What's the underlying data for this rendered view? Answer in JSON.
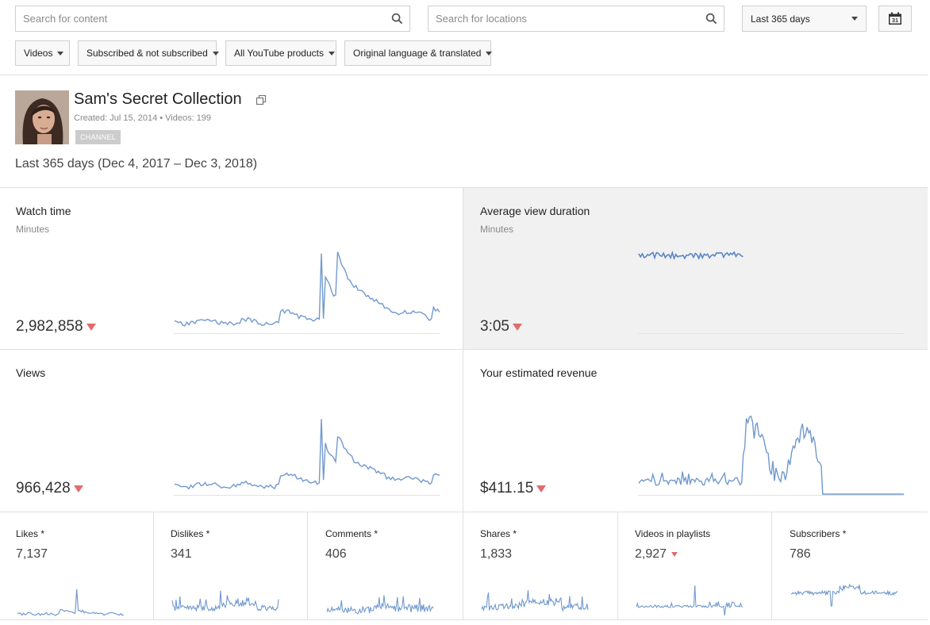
{
  "filters": {
    "search_content_placeholder": "Search for content",
    "search_locations_placeholder": "Search for locations",
    "date_range": "Last 365 days",
    "calendar_day": "31",
    "chips": [
      "Videos",
      "Subscribed & not subscribed",
      "All YouTube products",
      "Original language & translated"
    ]
  },
  "channel": {
    "name": "Sam's Secret Collection",
    "meta": "Created: Jul 15, 2014  •  Videos: 199",
    "badge": "CHANNEL"
  },
  "range_label": "Last 365 days (Dec 4, 2017 – Dec 3, 2018)",
  "colors": {
    "line": "#7199cf",
    "down": "#e06c6c",
    "card_highlight": "#f1f1f1"
  },
  "cards": {
    "watch_time": {
      "title": "Watch time",
      "sub": "Minutes",
      "value": "2,982,858",
      "trend": "down"
    },
    "avg_view_duration": {
      "title": "Average view duration",
      "sub": "Minutes",
      "value": "3:05",
      "trend": "down"
    },
    "views": {
      "title": "Views",
      "value": "966,428",
      "trend": "down"
    },
    "revenue": {
      "title": "Your estimated revenue",
      "value": "$411.15",
      "trend": "down"
    }
  },
  "small_cards": [
    {
      "title": "Likes *",
      "value": "7,137"
    },
    {
      "title": "Dislikes *",
      "value": "341"
    },
    {
      "title": "Comments *",
      "value": "406"
    },
    {
      "title": "Shares *",
      "value": "1,833"
    },
    {
      "title": "Videos in playlists",
      "value": "2,927",
      "trend": "down"
    },
    {
      "title": "Subscribers *",
      "value": "786"
    }
  ]
}
